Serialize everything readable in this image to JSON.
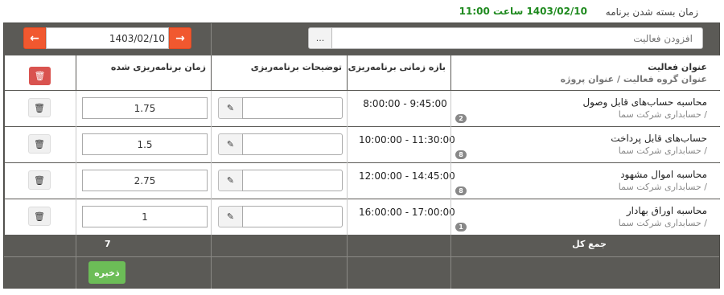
{
  "header": {
    "close_time_label": "زمان بسته شدن برنامه",
    "close_time_value": "1403/02/10 ساعت 11:00"
  },
  "toolbar": {
    "date_value": "1403/02/10",
    "prev_icon": "arrow-left-icon",
    "next_icon": "arrow-right-icon",
    "activity_placeholder": "افزودن فعالیت",
    "dots_label": "..."
  },
  "table": {
    "columns": {
      "activity_title": "عنوان فعالیت",
      "activity_group": "عنوان گروه فعالیت",
      "project_title": "عنوان پروژه",
      "time_range": "بازه زمانی برنامه‌ریزی",
      "description": "توضیحات برنامه‌ریزی",
      "planned_time": "زمان برنامه‌ریزی شده"
    },
    "rows": [
      {
        "title": "محاسبه حساب‌های قابل وصول",
        "sub": "/ حسابداری شرکت سما",
        "badge": "2",
        "start": "8:00:00",
        "end": "9:45:00",
        "hours": "1.75"
      },
      {
        "title": "حساب‌های قابل پرداخت",
        "sub": "/ حسابداری شرکت سما",
        "badge": "8",
        "start": "10:00:00",
        "end": "11:30:00",
        "hours": "1.5"
      },
      {
        "title": "محاسبه اموال مشهود",
        "sub": "/ حسابداری شرکت سما",
        "badge": "8",
        "start": "12:00:00",
        "end": "14:45:00",
        "hours": "2.75"
      },
      {
        "title": "محاسبه اوراق بهادار",
        "sub": "/ حسابداری شرکت سما",
        "badge": "1",
        "start": "16:00:00",
        "end": "17:00:00",
        "hours": "1"
      }
    ],
    "total_label": "جمع کل",
    "total_value": "7",
    "save_label": "ذخیره"
  },
  "colors": {
    "accent_orange": "#f1582f",
    "danger_red": "#d9534f",
    "save_green": "#6cbd57",
    "close_time_green": "#1f8a1f",
    "grid_dark": "#5b5a56"
  }
}
